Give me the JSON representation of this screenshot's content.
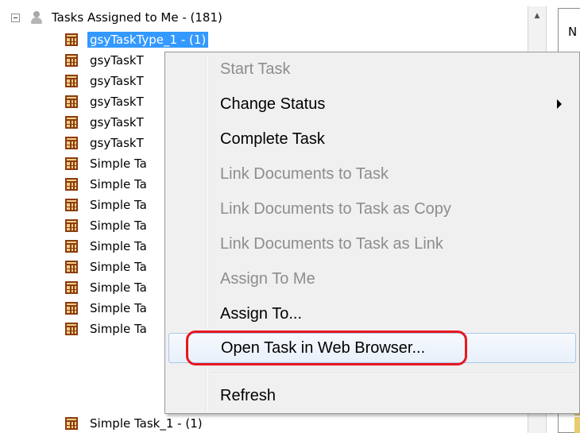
{
  "tree": {
    "root_label": "Tasks Assigned to Me - (181)",
    "items": [
      {
        "label": "gsyTaskType_1 - (1)",
        "selected": true
      },
      {
        "label": "gsyTaskT"
      },
      {
        "label": "gsyTaskT"
      },
      {
        "label": "gsyTaskT"
      },
      {
        "label": "gsyTaskT"
      },
      {
        "label": "gsyTaskT"
      },
      {
        "label": "Simple Ta"
      },
      {
        "label": "Simple Ta"
      },
      {
        "label": "Simple Ta"
      },
      {
        "label": "Simple Ta"
      },
      {
        "label": "Simple Ta"
      },
      {
        "label": "Simple Ta"
      },
      {
        "label": "Simple Ta"
      },
      {
        "label": "Simple Ta"
      },
      {
        "label": "Simple Ta"
      },
      {
        "label": "Simple Task_1 - (1)"
      }
    ]
  },
  "side_panel": {
    "label": "N"
  },
  "context_menu": {
    "items": [
      {
        "label": "Start Task",
        "disabled": true
      },
      {
        "label": "Change Status",
        "disabled": false,
        "submenu": true
      },
      {
        "label": "Complete Task",
        "disabled": false
      },
      {
        "label": "Link Documents to Task",
        "disabled": true
      },
      {
        "label": "Link Documents to Task as Copy",
        "disabled": true
      },
      {
        "label": "Link Documents to Task as Link",
        "disabled": true
      },
      {
        "label": "Assign To Me",
        "disabled": true
      },
      {
        "label": "Assign To...",
        "disabled": false
      },
      {
        "label": "Open Task in Web Browser...",
        "disabled": false,
        "highlighted": true
      },
      {
        "label": "Refresh",
        "disabled": false
      }
    ]
  },
  "colors": {
    "selection": "#3399ff",
    "annotation": "#e8171d",
    "disabled_text": "#8d8d8d"
  }
}
